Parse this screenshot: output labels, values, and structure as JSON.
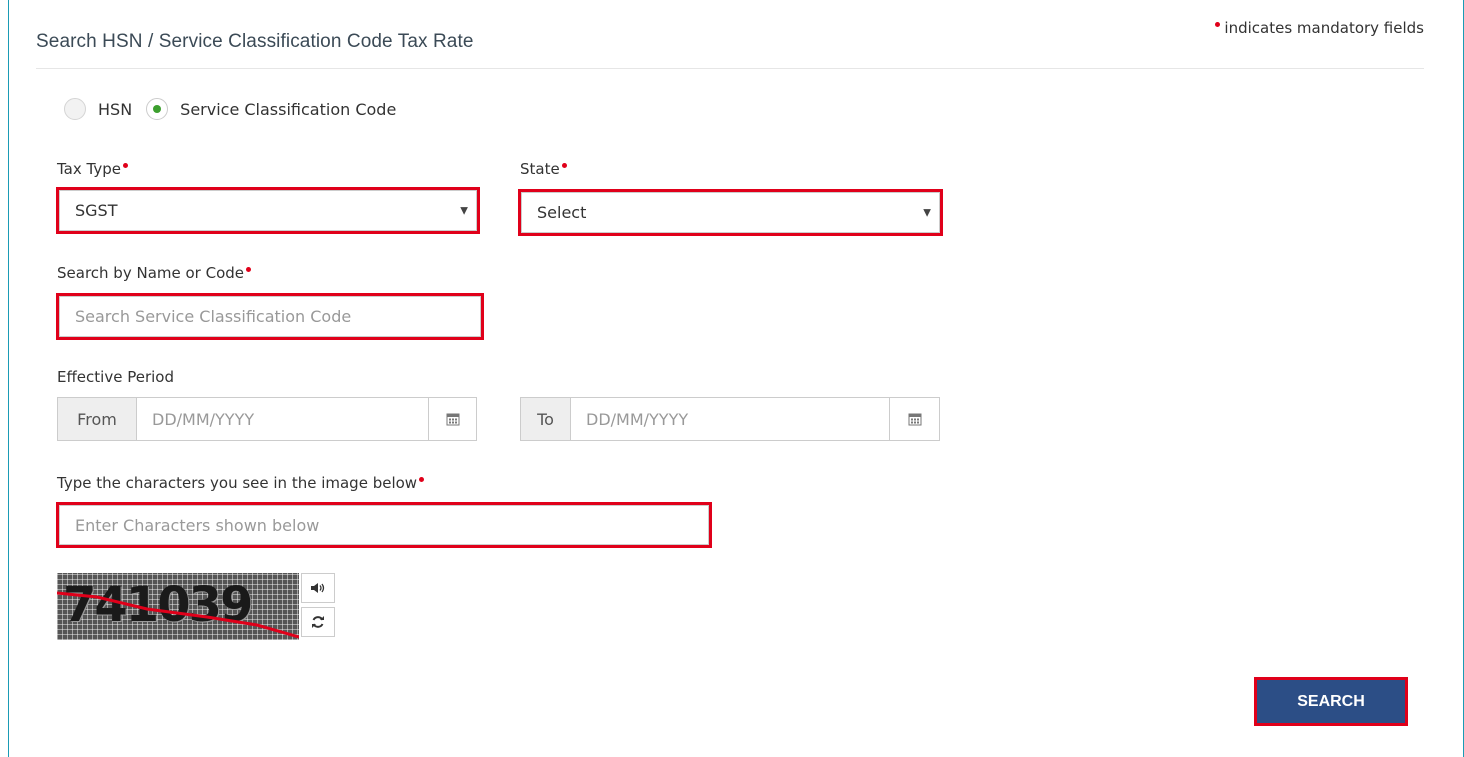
{
  "header": {
    "title": "Search HSN / Service Classification Code Tax Rate",
    "mandatory_note": "indicates mandatory fields"
  },
  "search_type": {
    "options": [
      {
        "label": "HSN",
        "selected": false
      },
      {
        "label": "Service Classification Code",
        "selected": true
      }
    ]
  },
  "tax_type": {
    "label": "Tax Type",
    "value": "SGST"
  },
  "state": {
    "label": "State",
    "value": "Select"
  },
  "search_by": {
    "label": "Search by Name or Code",
    "placeholder": "Search Service Classification Code"
  },
  "effective_period": {
    "label": "Effective Period",
    "from_label": "From",
    "from_placeholder": "DD/MM/YYYY",
    "to_label": "To",
    "to_placeholder": "DD/MM/YYYY"
  },
  "captcha": {
    "label": "Type the characters you see in the image below",
    "placeholder": "Enter Characters shown below",
    "image_text": "741039"
  },
  "actions": {
    "search_label": "SEARCH"
  },
  "colors": {
    "accent_border": "#1a9bb5",
    "highlight_red": "#e0001a",
    "primary_button": "#2c4e86",
    "radio_checked": "#3c9f2e"
  }
}
